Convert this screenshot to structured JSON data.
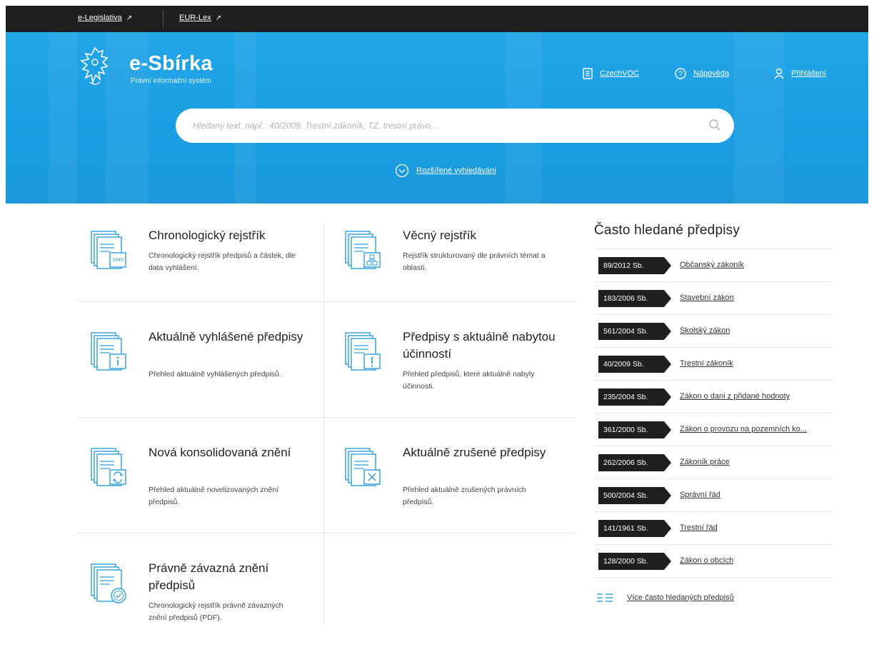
{
  "topbar": {
    "links": [
      {
        "label": "e-Legislativa",
        "icon": "external-link-icon"
      },
      {
        "label": "EUR-Lex",
        "icon": "external-link-icon"
      }
    ]
  },
  "header": {
    "title": "e-Sbírka",
    "subtitle": "Právní informační systém",
    "nav": [
      {
        "label": "CzechVOC",
        "icon": "document-icon"
      },
      {
        "label": "Nápověda",
        "icon": "help-icon"
      },
      {
        "label": "Přihlášení",
        "icon": "user-icon"
      }
    ]
  },
  "search": {
    "placeholder": "Hledaný text, např.: 40/2009, Trestní zákoník, TZ, trestní právo...",
    "advanced_label": "Rozšířené vyhledávání"
  },
  "tiles": [
    {
      "title": "Chronologický rejstřík",
      "desc": "Chronologický rejstřík předpisů a částek, dle data vyhlášení.",
      "icon_label": "1945"
    },
    {
      "title": "Věcný rejstřík",
      "desc": "Rejstřík strukturovaný dle právních témat a oblastí."
    },
    {
      "title": "Aktuálně vyhlášené předpisy",
      "desc": "Přehled aktuálně vyhlášených předpisů."
    },
    {
      "title": "Předpisy s aktuálně nabytou účinností",
      "desc": "Přehled předpisů, které aktuálně nabyly účinnosti."
    },
    {
      "title": "Nová konsolidovaná znění",
      "desc": "Přehled aktuálně novelizovaných znění předpisů."
    },
    {
      "title": "Aktuálně zrušené předpisy",
      "desc": "Přehled aktuálně zrušených právních předpisů."
    },
    {
      "title": "Právně závazná znění předpisů",
      "desc": "Chronologický rejstřík právně závazných znění předpisů (PDF)."
    }
  ],
  "frequent": {
    "title": "Často hledané předpisy",
    "items": [
      {
        "code": "89/2012 Sb.",
        "name": "Občanský zákoník"
      },
      {
        "code": "183/2006 Sb.",
        "name": "Stavební zákon"
      },
      {
        "code": "561/2004 Sb.",
        "name": "Školský zákon"
      },
      {
        "code": "40/2009 Sb.",
        "name": "Trestní zákoník"
      },
      {
        "code": "235/2004 Sb.",
        "name": "Zákon o dani z přidané hodnoty"
      },
      {
        "code": "361/2000 Sb.",
        "name": "Zákon o provozu na pozemních ko..."
      },
      {
        "code": "262/2006 Sb.",
        "name": "Zákoník práce"
      },
      {
        "code": "500/2004 Sb.",
        "name": "Správní řád"
      },
      {
        "code": "141/1961 Sb.",
        "name": "Trestní řád"
      },
      {
        "code": "128/2000 Sb.",
        "name": "Zákon o obcích"
      }
    ],
    "more_label": "Více často hledaných předpisů"
  },
  "colors": {
    "hero_blue": "#1a9ee3",
    "dark": "#1f1f1f",
    "icon_blue": "#2a9fdc"
  }
}
